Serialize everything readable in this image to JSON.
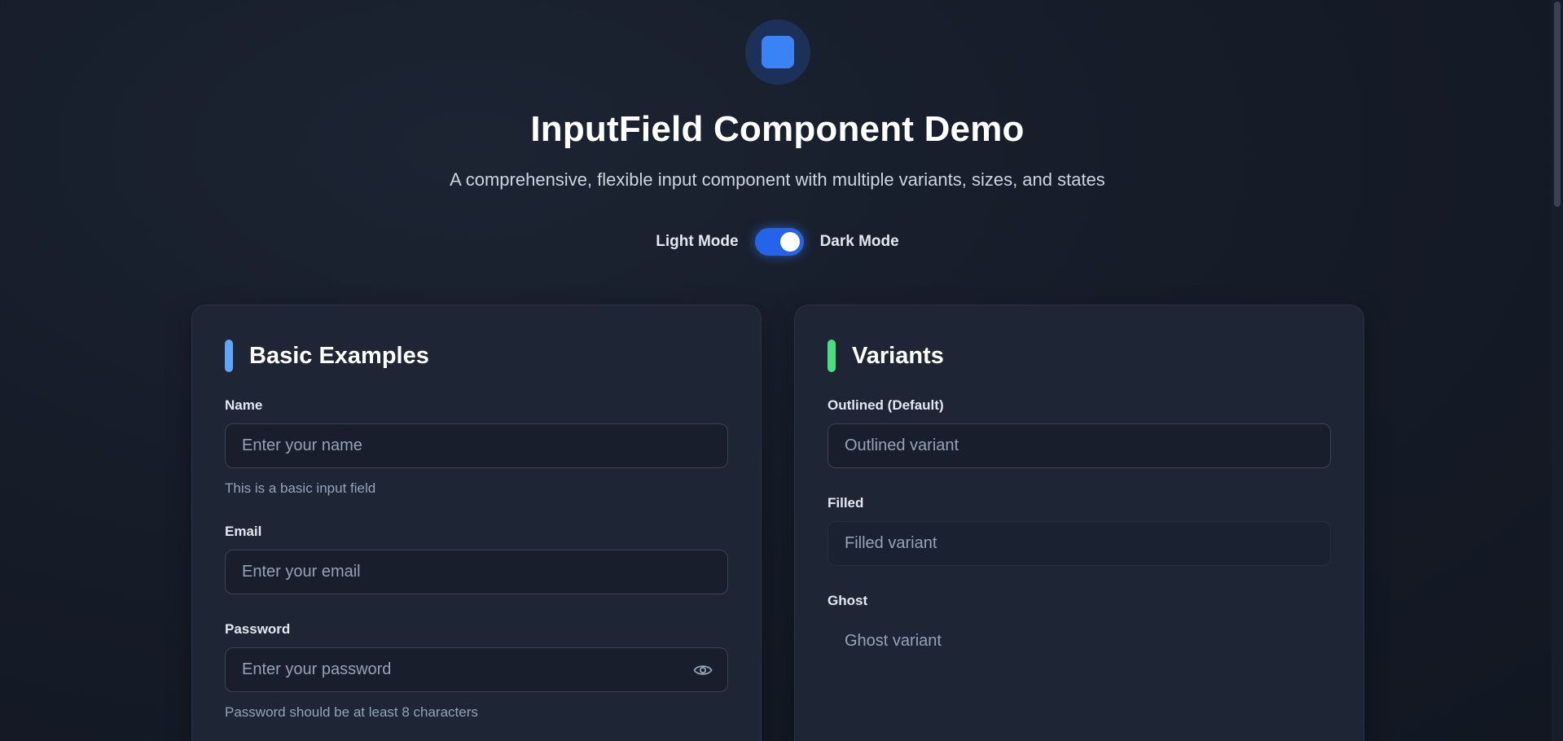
{
  "header": {
    "logo_icon": "square-logo-icon",
    "title": "InputField Component Demo",
    "subtitle": "A comprehensive, flexible input component with multiple variants, sizes, and states"
  },
  "theme_toggle": {
    "light_label": "Light Mode",
    "dark_label": "Dark Mode",
    "state": "dark",
    "accent": "#2563eb"
  },
  "basic_examples": {
    "title": "Basic Examples",
    "accent": "#60a5fa",
    "fields": [
      {
        "label": "Name",
        "placeholder": "Enter your name",
        "helper": "This is a basic input field"
      },
      {
        "label": "Email",
        "placeholder": "Enter your email",
        "helper": ""
      },
      {
        "label": "Password",
        "placeholder": "Enter your password",
        "helper": "Password should be at least 8 characters",
        "icon": "eye-icon"
      }
    ]
  },
  "variants": {
    "title": "Variants",
    "accent": "#4ade80",
    "fields": [
      {
        "label": "Outlined (Default)",
        "placeholder": "Outlined variant"
      },
      {
        "label": "Filled",
        "placeholder": "Filled variant"
      },
      {
        "label": "Ghost",
        "placeholder": "Ghost variant"
      }
    ]
  }
}
